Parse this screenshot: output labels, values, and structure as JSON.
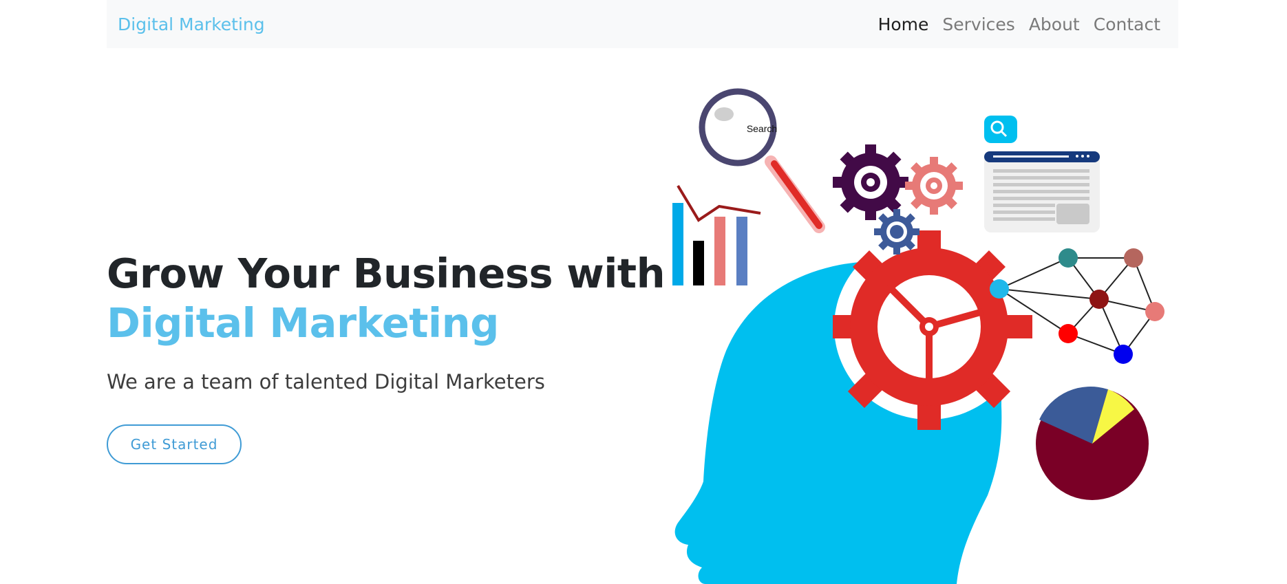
{
  "navbar": {
    "brand": "Digital Marketing",
    "links": [
      {
        "label": "Home",
        "active": true
      },
      {
        "label": "Services",
        "active": false
      },
      {
        "label": "About",
        "active": false
      },
      {
        "label": "Contact",
        "active": false
      }
    ]
  },
  "hero": {
    "title_line1": "Grow Your Business with",
    "title_line2": "Digital Marketing",
    "subtitle": "We are a team of talented Digital Marketers",
    "cta_label": "Get Started"
  },
  "illustration": {
    "magnifier_label": "Search"
  },
  "colors": {
    "brand": "#5bc0eb",
    "head": "#00bfef",
    "gear_red": "#e02b27",
    "cta_border": "#3f9bd5"
  }
}
